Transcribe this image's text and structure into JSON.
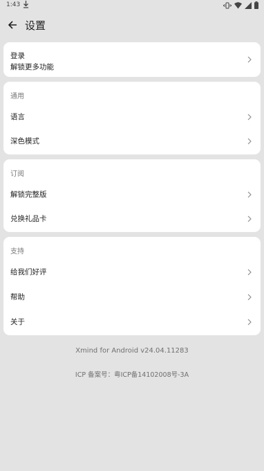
{
  "status_bar": {
    "time": "1:43",
    "icons": [
      "download-icon",
      "vibrate-icon",
      "wifi-icon",
      "signal-icon",
      "battery-icon"
    ]
  },
  "app_bar": {
    "back_icon": "arrow-left-icon",
    "title": "设置"
  },
  "login": {
    "title": "登录",
    "subtitle": "解锁更多功能"
  },
  "general": {
    "header": "通用",
    "items": [
      {
        "label": "语言"
      },
      {
        "label": "深色模式"
      }
    ]
  },
  "subscribe": {
    "header": "订阅",
    "items": [
      {
        "label": "解锁完整版"
      },
      {
        "label": "兑换礼品卡"
      }
    ]
  },
  "support": {
    "header": "支持",
    "items": [
      {
        "label": "给我们好评"
      },
      {
        "label": "帮助"
      },
      {
        "label": "关于"
      }
    ]
  },
  "footer": {
    "version": "Xmind for Android v24.04.11283",
    "icp": "ICP 备案号：粤ICP备14102008号-3A"
  },
  "colors": {
    "background": "#e3e3e3",
    "card": "#ffffff",
    "text": "#1f1f1f",
    "muted": "#7a7a7a"
  }
}
